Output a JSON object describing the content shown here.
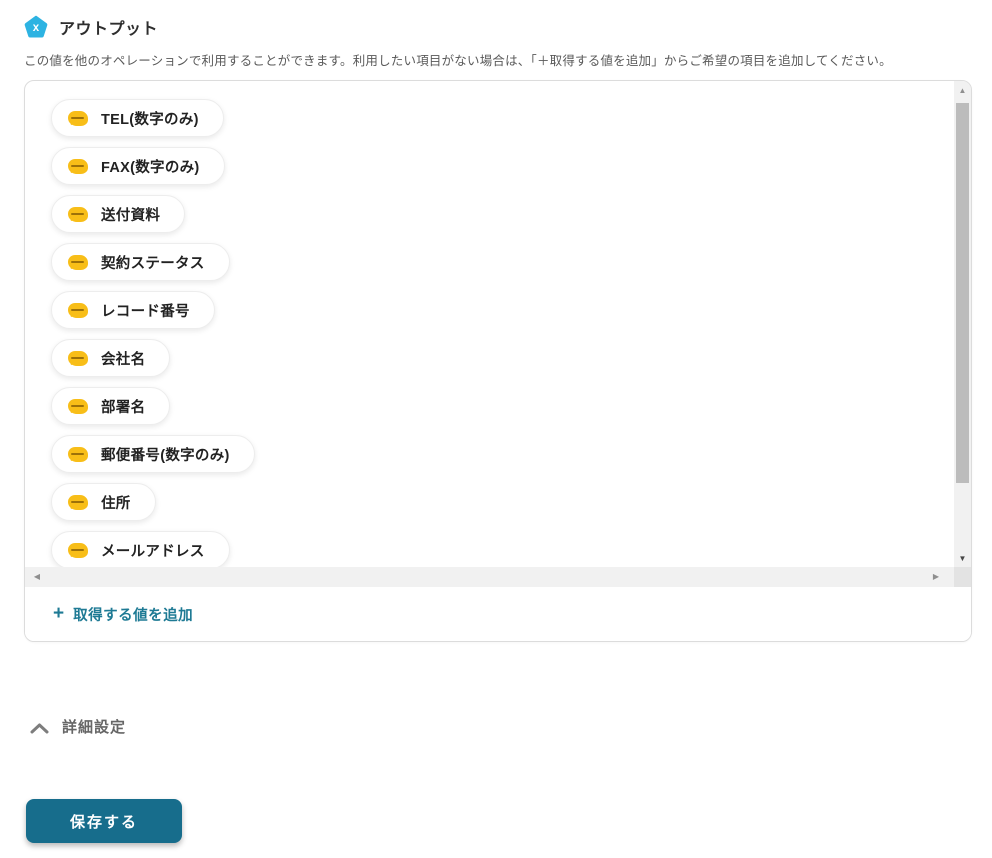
{
  "colors": {
    "accent_teal": "#176D8C",
    "link_teal": "#1E7A94",
    "header_icon_cyan": "#2DB3E2",
    "chip_icon_yellow": "#F8BE18"
  },
  "icons": {
    "up_arrow": "▲",
    "down_arrow": "▼",
    "left_arrow": "◀",
    "right_arrow": "▶"
  },
  "header": {
    "title": "アウトプット",
    "icon_glyph": "x"
  },
  "description": "この値を他のオペレーションで利用することができます。利用したい項目がない場合は、「＋取得する値を追加」からご希望の項目を追加してください。",
  "output_panel": {
    "chips": [
      {
        "label": "TEL(数字のみ)"
      },
      {
        "label": "FAX(数字のみ)"
      },
      {
        "label": "送付資料"
      },
      {
        "label": "契約ステータス"
      },
      {
        "label": "レコード番号"
      },
      {
        "label": "会社名"
      },
      {
        "label": "部署名"
      },
      {
        "label": "郵便番号(数字のみ)"
      },
      {
        "label": "住所"
      },
      {
        "label": "メールアドレス"
      }
    ],
    "add_value_button": {
      "plus_glyph": "+",
      "label": "取得する値を追加"
    }
  },
  "advanced_settings": {
    "label": "詳細設定"
  },
  "save_button": {
    "label": "保存する"
  }
}
